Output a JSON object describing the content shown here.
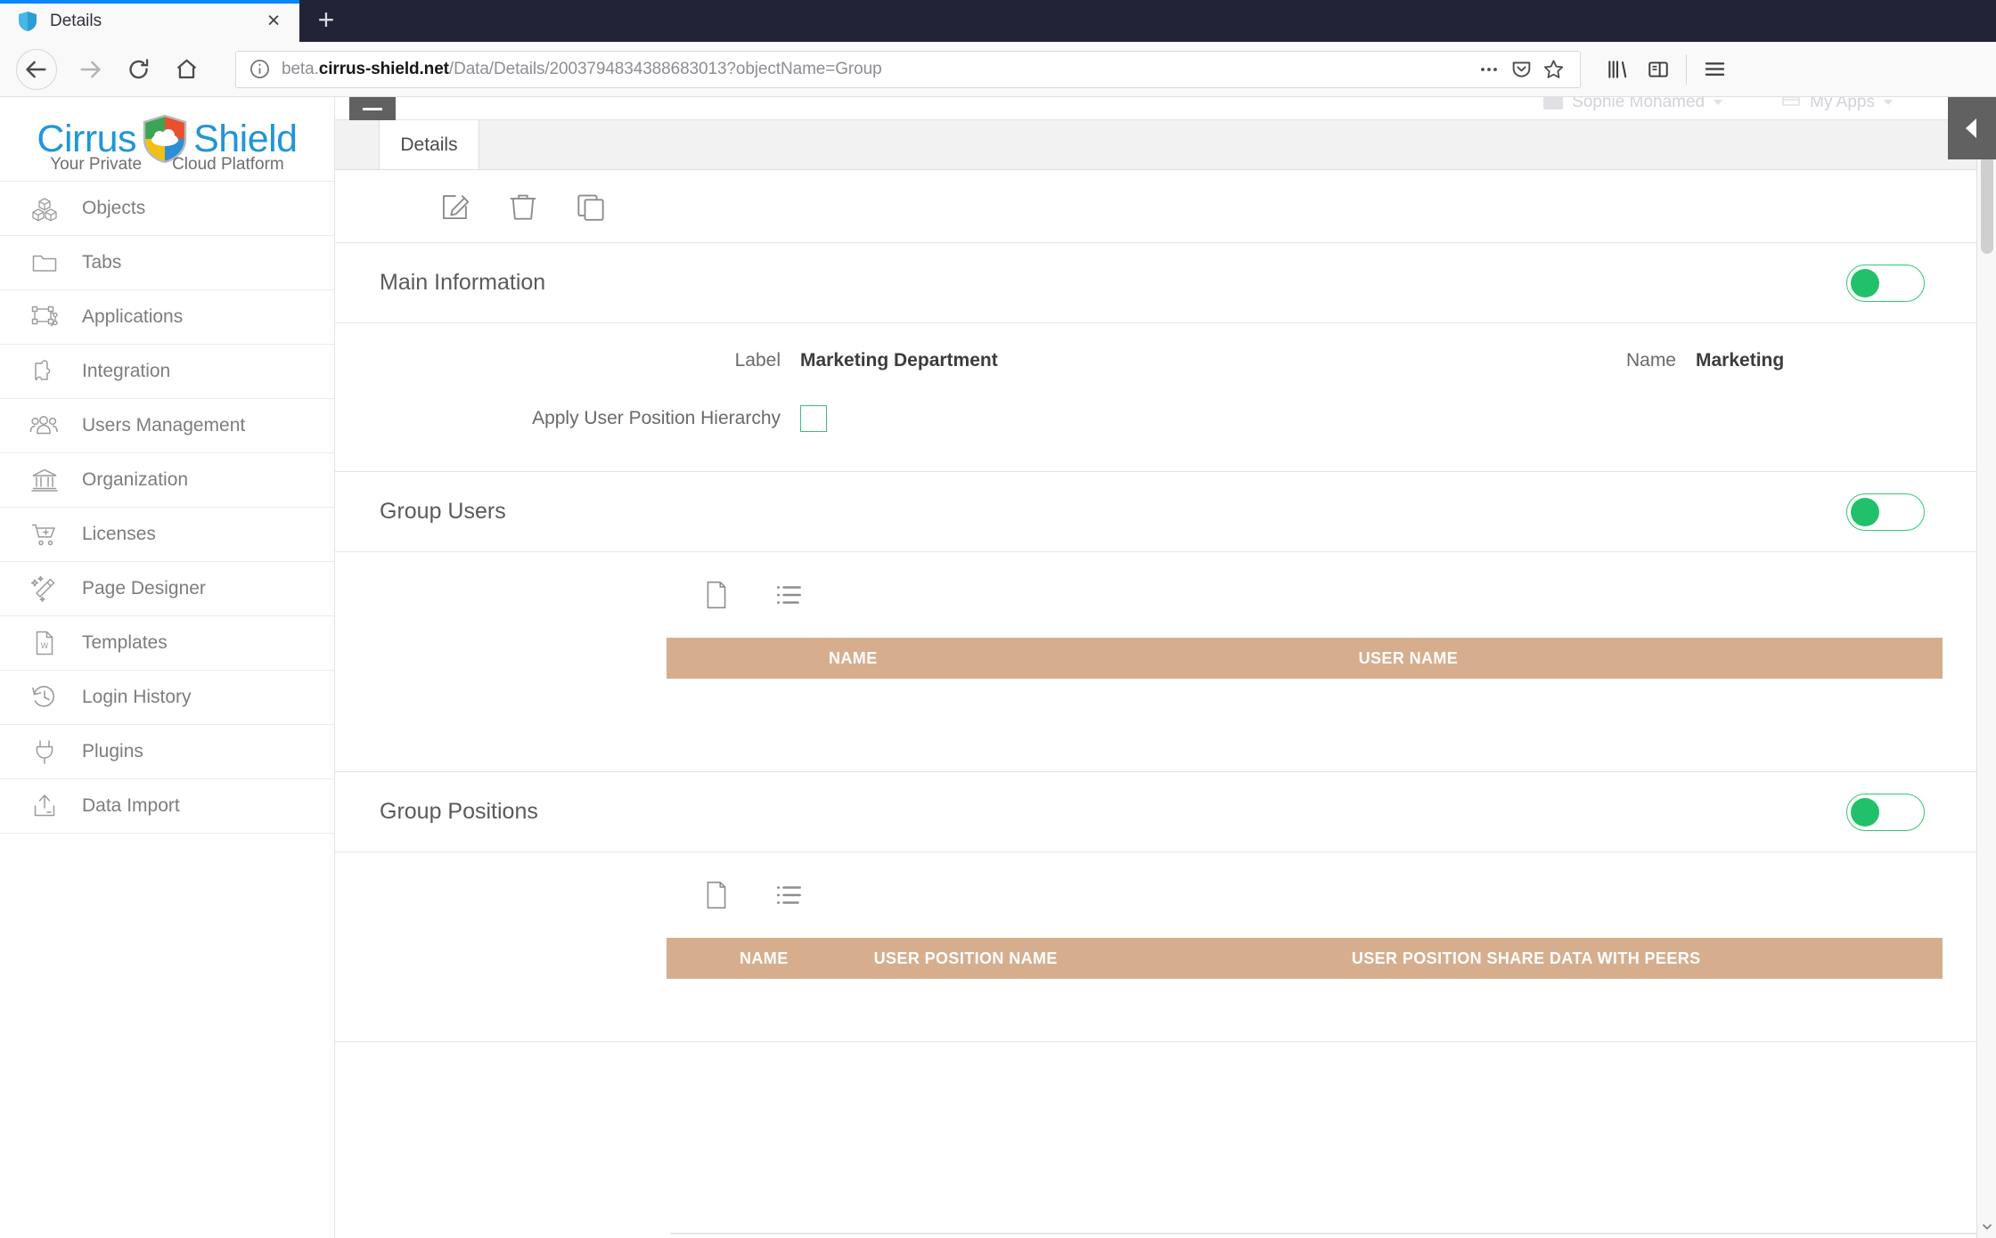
{
  "browser": {
    "tab": {
      "title": "Details",
      "favicon": "shield-icon",
      "close": "×"
    },
    "new_tab_label": "+",
    "nav": {
      "back": "back-arrow-icon",
      "forward": "forward-arrow-icon",
      "reload": "reload-icon",
      "home": "home-icon"
    },
    "url": {
      "prefix": "beta.",
      "domain": "cirrus-shield.net",
      "path": "/Data/Details/2003794834388683013?objectName=Group",
      "full": "beta.cirrus-shield.net/Data/Details/2003794834388683013?objectName=Group",
      "info_icon": "info-circle-icon"
    },
    "url_icons": [
      "ellipsis-icon",
      "pocket-icon",
      "star-bookmark-icon"
    ],
    "toolbar_icons": [
      "library-icon",
      "sidebar-icon",
      "hamburger-menu-icon"
    ]
  },
  "sidebar": {
    "logo": {
      "word1": "Cirrus",
      "word2": "Shield",
      "tagline_left": "Your Private",
      "tagline_right": "Cloud Platform",
      "icon": "cirrus-shield-logo-icon",
      "brand_color": "#2196d6",
      "shield_colors": [
        "#3aa655",
        "#e8502e",
        "#f2c014",
        "#2b8fd6"
      ]
    },
    "items": [
      {
        "label": "Objects",
        "icon": "cubes-icon"
      },
      {
        "label": "Tabs",
        "icon": "folder-icon"
      },
      {
        "label": "Applications",
        "icon": "application-frame-icon"
      },
      {
        "label": "Integration",
        "icon": "puzzle-piece-icon"
      },
      {
        "label": "Users Management",
        "icon": "users-group-icon"
      },
      {
        "label": "Organization",
        "icon": "bank-building-icon"
      },
      {
        "label": "Licenses",
        "icon": "cart-plus-icon"
      },
      {
        "label": "Page Designer",
        "icon": "magic-wand-icon"
      },
      {
        "label": "Templates",
        "icon": "word-document-icon"
      },
      {
        "label": "Login History",
        "icon": "clock-history-icon"
      },
      {
        "label": "Plugins",
        "icon": "plug-icon"
      },
      {
        "label": "Data Import",
        "icon": "upload-tray-icon"
      }
    ]
  },
  "topbar": {
    "user_name": "Sophie Mohamed",
    "apps_label": "My Apps",
    "user_icon": "user-avatar-icon",
    "apps_icon": "apps-grid-icon",
    "collapse_icon": "collapse-left-chevron-icon",
    "menu_icon": "menu-bar-icon"
  },
  "page": {
    "tabs": [
      {
        "label": "Details",
        "active": true
      }
    ],
    "actions": [
      {
        "name": "edit",
        "icon": "edit-pencil-icon"
      },
      {
        "name": "delete",
        "icon": "trash-icon"
      },
      {
        "name": "clone",
        "icon": "copy-clone-icon"
      }
    ]
  },
  "sections": [
    {
      "title": "Main Information",
      "toggle_on": true,
      "fields": [
        {
          "label": "Label",
          "value": "Marketing Department",
          "type": "text"
        },
        {
          "label": "Name",
          "value": "Marketing",
          "type": "text"
        },
        {
          "label": "Apply User Position Hierarchy",
          "value": "",
          "type": "checkbox",
          "checked": false
        }
      ]
    },
    {
      "title": "Group Users",
      "toggle_on": true,
      "tools": [
        {
          "name": "new-record",
          "icon": "document-page-icon"
        },
        {
          "name": "list-view",
          "icon": "bulleted-list-icon"
        }
      ],
      "grid": {
        "columns": [
          "NAME",
          "USER NAME"
        ],
        "rows": []
      }
    },
    {
      "title": "Group Positions",
      "toggle_on": true,
      "tools": [
        {
          "name": "new-record",
          "icon": "document-page-icon"
        },
        {
          "name": "list-view",
          "icon": "bulleted-list-icon"
        }
      ],
      "grid": {
        "columns": [
          "NAME",
          "USER POSITION NAME",
          "USER POSITION SHARE DATA WITH PEERS"
        ],
        "rows": []
      }
    }
  ],
  "colors": {
    "toggle_green": "#21c16b",
    "grid_header_tan": "#d6ae8e",
    "tab_accent_blue": "#0a84ff",
    "chrome_dark": "#232338"
  }
}
